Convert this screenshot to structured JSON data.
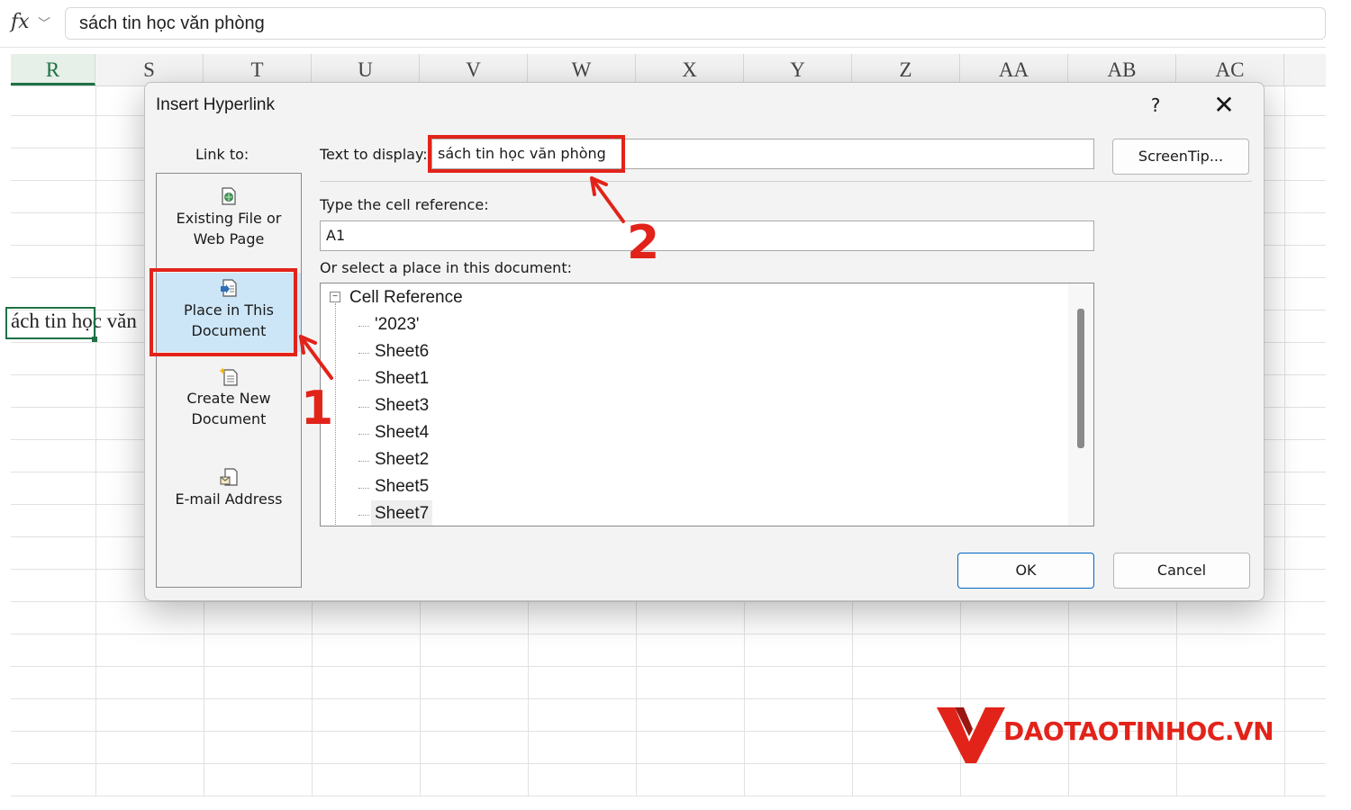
{
  "formula_bar": {
    "fx_label": "fx",
    "value": "sách tin học văn phòng"
  },
  "columns": [
    "R",
    "S",
    "T",
    "U",
    "V",
    "W",
    "X",
    "Y",
    "Z",
    "AA",
    "AB",
    "AC"
  ],
  "active_column": "R",
  "cell_text": "ách tin học văn",
  "dialog": {
    "title": "Insert Hyperlink",
    "help_label": "?",
    "close_label": "✕",
    "link_to_label": "Link to:",
    "link_items": [
      {
        "line1": "Existing File or",
        "line2": "Web Page",
        "icon": "globe-document-icon"
      },
      {
        "line1": "Place in This",
        "line2": "Document",
        "icon": "document-place-icon"
      },
      {
        "line1": "Create New",
        "line2": "Document",
        "icon": "new-document-icon"
      },
      {
        "line1": "E-mail Address",
        "line2": "",
        "icon": "email-icon"
      }
    ],
    "selected_link": "Place in This Document",
    "text_to_display_label": "Text to display:",
    "text_to_display_value": "sách tin học văn phòng",
    "screentip_label": "ScreenTip...",
    "cell_ref_label": "Type the cell reference:",
    "cell_ref_value": "A1",
    "place_label": "Or select a place in this document:",
    "tree": {
      "toggle": "−",
      "root": "Cell Reference",
      "items": [
        "'2023'",
        "Sheet6",
        "Sheet1",
        "Sheet3",
        "Sheet4",
        "Sheet2",
        "Sheet5",
        "Sheet7"
      ],
      "selected": "Sheet7"
    },
    "ok_label": "OK",
    "cancel_label": "Cancel"
  },
  "annotations": {
    "step1": "1",
    "step2": "2"
  },
  "watermark": {
    "text": "DAOTAOTINHOC.VN"
  },
  "colors": {
    "highlight": "#e2231a",
    "excel_green": "#1e7145",
    "selection_blue": "#cde6f7"
  }
}
